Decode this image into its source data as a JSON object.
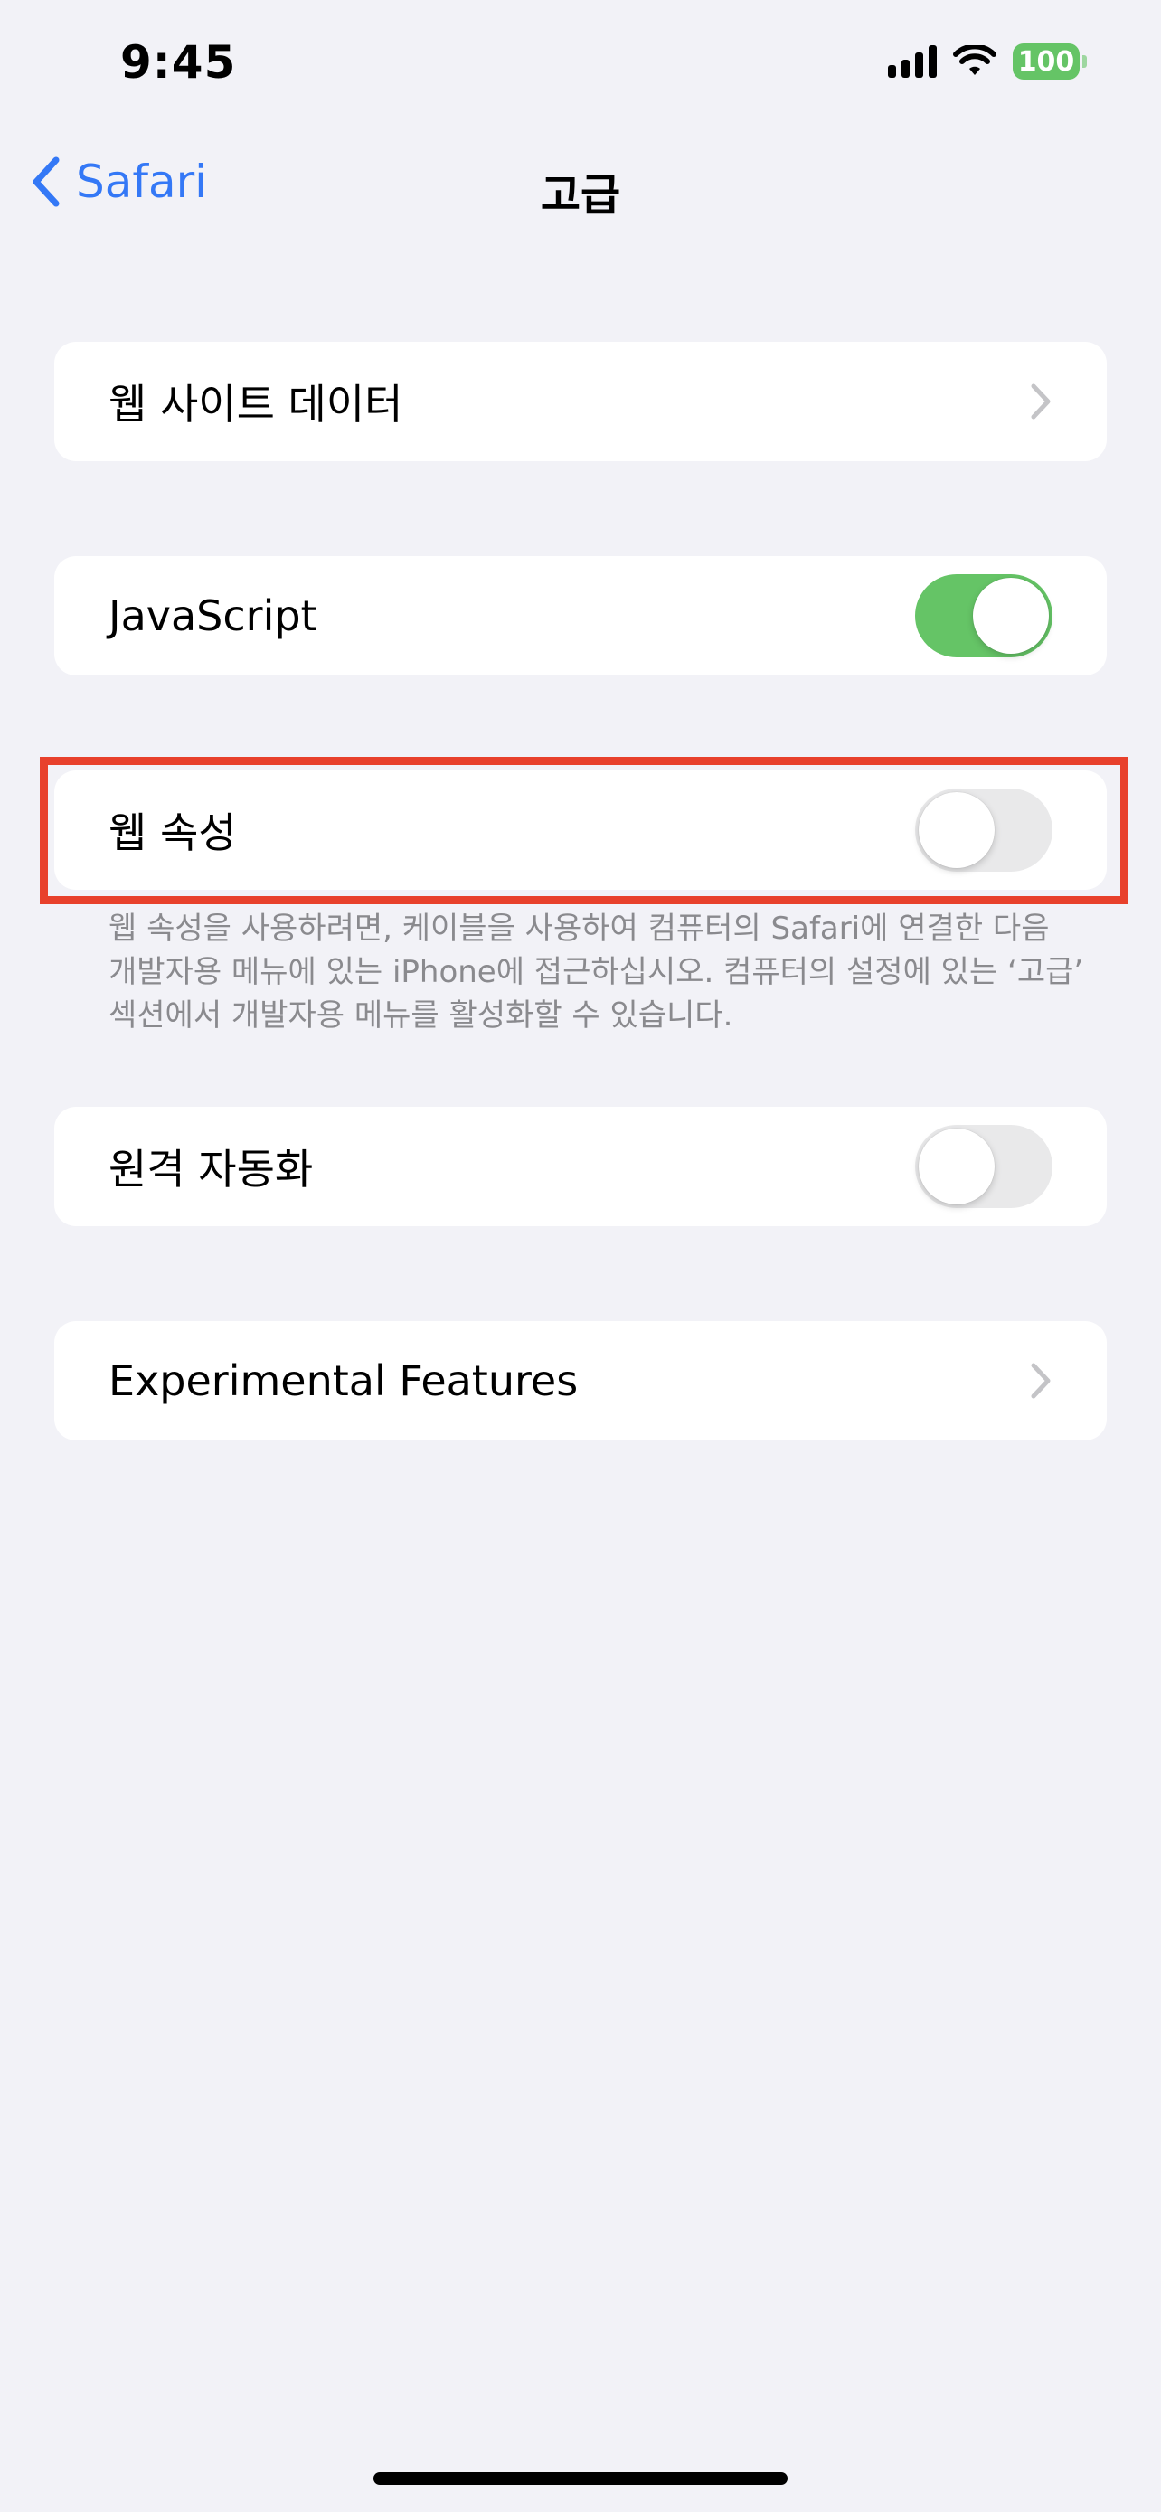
{
  "status_bar": {
    "time": "9:45",
    "battery": "100",
    "icons": [
      "cellular-signal-icon",
      "wifi-icon",
      "battery-icon"
    ]
  },
  "nav": {
    "back_label": "Safari",
    "title": "고급"
  },
  "rows": {
    "website_data": "웹 사이트 데이터",
    "javascript": {
      "label": "JavaScript",
      "enabled": true
    },
    "web_inspector": {
      "label": "웹 속성",
      "enabled": false
    },
    "web_inspector_footnote": "웹 속성을 사용하려면, 케이블을 사용하여 컴퓨터의 Safari에 연결한 다음 개발자용 메뉴에 있는 iPhone에 접근하십시오. 컴퓨터의 설정에 있는 ‘고급’ 섹션에서 개발자용 메뉴를 활성화할 수 있습니다.",
    "remote_automation": {
      "label": "원격 자동화",
      "enabled": false
    },
    "experimental_features": "Experimental Features"
  },
  "colors": {
    "accent": "#3478f6",
    "toggle_on": "#65c466",
    "toggle_off": "#e9e9ea",
    "highlight": "#e8412c",
    "background": "#f2f2f7"
  }
}
